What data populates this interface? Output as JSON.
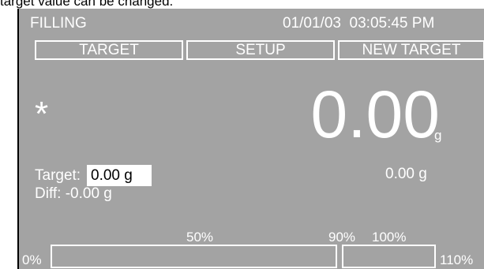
{
  "caption": "target value can be changed.",
  "header": {
    "mode": "FILLING",
    "date": "01/01/03",
    "time": "03:05:45 PM"
  },
  "tabs": [
    {
      "label": "TARGET"
    },
    {
      "label": "SETUP"
    },
    {
      "label": "NEW TARGET"
    }
  ],
  "display": {
    "status_symbol": "*",
    "value": "0.00",
    "unit": "g"
  },
  "target": {
    "label": "Target:",
    "value": "0.00 g",
    "secondary_value": "0.00 g"
  },
  "diff": {
    "text": "Diff: -0.00 g"
  },
  "progress": {
    "labels": {
      "p0": "0%",
      "p50": "50%",
      "p90": "90%",
      "p100": "100%",
      "p110": "110%"
    },
    "fill_fraction": 0
  },
  "colors": {
    "screen_background": "#a3a3a3",
    "foreground": "#ffffff"
  }
}
